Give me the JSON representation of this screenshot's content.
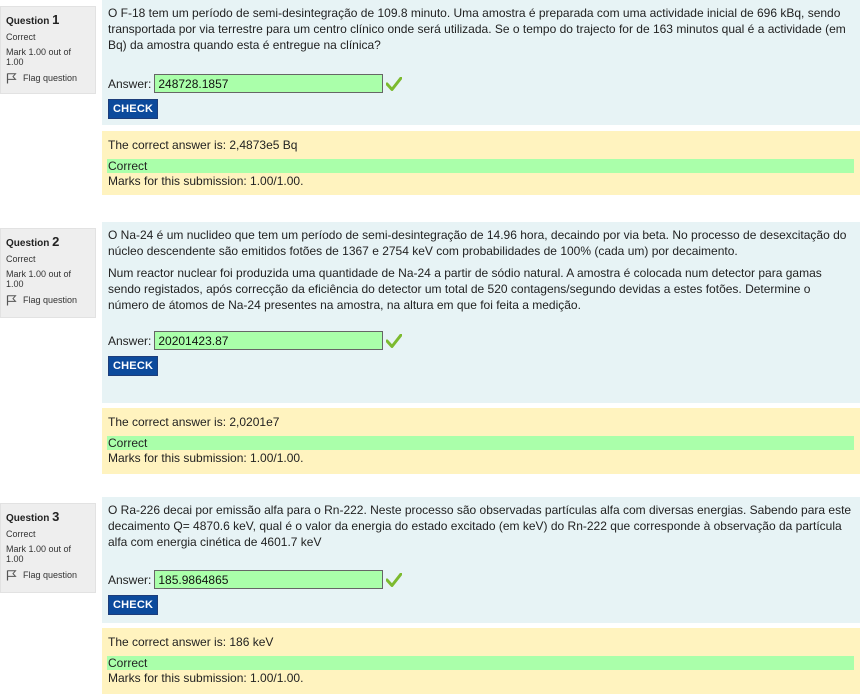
{
  "common": {
    "answer_label": "Answer:",
    "check_label": "CHECK",
    "flag_label": "Flag question",
    "icons": {
      "flag": "flag-icon",
      "tick": "checkmark-icon"
    },
    "colors": {
      "correct_bg": "#aaffaa",
      "question_bg": "#e7f3f5",
      "feedback_bg": "#fff3bf",
      "check_button": "#0c4a9c",
      "tick": "#7cba2f"
    }
  },
  "questions": [
    {
      "label": "Question",
      "number": "1",
      "state": "Correct",
      "grade": "Mark 1.00 out of 1.00",
      "text": [
        "O F-18 tem um período de semi-desintegração de 109.8 minuto. Uma amostra é preparada com uma actividade inicial de 696 kBq, sendo transportada por via terrestre para um centro clínico onde será utilizada. Se o tempo do trajecto for de 163 minutos qual é a actividade (em Bq) da amostra quando esta é entregue na clínica?"
      ],
      "answer": "248728.1857",
      "right_answer": "The correct answer is: 2,4873e5 Bq",
      "correctness": "Correct",
      "marks": "Marks for this submission: 1.00/1.00."
    },
    {
      "label": "Question",
      "number": "2",
      "state": "Correct",
      "grade": "Mark 1.00 out of 1.00",
      "text": [
        "O Na-24 é um nuclideo que tem um período de semi-desintegração de 14.96 hora, decaindo por via beta. No processo de desexcitação do núcleo descendente são emitidos fotões de 1367 e 2754 keV com probabilidades de 100% (cada um) por decaimento.",
        "Num reactor nuclear foi produzida uma quantidade de Na-24 a partir de sódio natural. A amostra é colocada num detector para gamas sendo registados, após correcção da eficiência do detector um total de 520 contagens/segundo devidas a estes fotões. Determine o número de átomos de Na-24 presentes na amostra, na altura em que foi feita a medição."
      ],
      "answer": "20201423.87",
      "right_answer": "The correct answer is: 2,0201e7",
      "correctness": "Correct",
      "marks": "Marks for this submission: 1.00/1.00."
    },
    {
      "label": "Question",
      "number": "3",
      "state": "Correct",
      "grade": "Mark 1.00 out of 1.00",
      "text": [
        "O Ra-226 decai por emissão alfa para o Rn-222. Neste processo são observadas partículas alfa com diversas energias. Sabendo para este decaimento Q= 4870.6 keV, qual é o valor da energia do estado excitado (em keV) do Rn-222 que corresponde à observação da partícula alfa com energia cinética de 4601.7 keV"
      ],
      "answer": "185.9864865",
      "right_answer": "The correct answer is: 186 keV",
      "correctness": "Correct",
      "marks": "Marks for this submission: 1.00/1.00."
    }
  ]
}
